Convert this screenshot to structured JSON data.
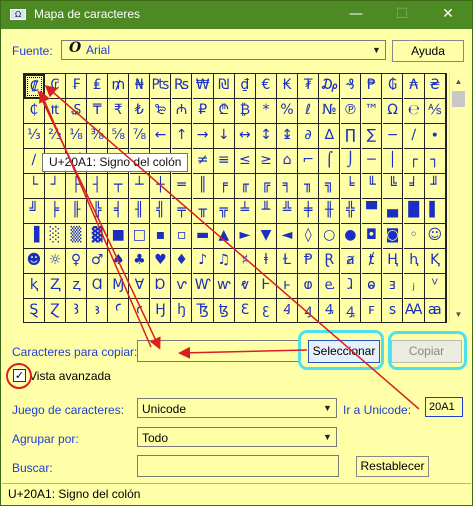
{
  "window": {
    "title": "Mapa de caracteres",
    "controls": {
      "minimize": "—",
      "maximize": "☐",
      "close": "✕"
    }
  },
  "font": {
    "label": "Fuente:",
    "icon_glyph": "O",
    "value": "Arial",
    "help_button": "Ayuda"
  },
  "grid": {
    "rows": [
      [
        "₡",
        "₢",
        "₣",
        "₤",
        "₥",
        "₦",
        "₧",
        "₨",
        "₩",
        "₪",
        "₫",
        "€",
        "₭",
        "₮",
        "₯",
        "₰",
        "₱",
        "₲",
        "₳",
        "₴"
      ],
      [
        "₵",
        "₶",
        "₷",
        "₸",
        "₹",
        "₺",
        "₻",
        "₼",
        "₽",
        "₾",
        "₿",
        "*",
        "%",
        "ℓ",
        "№",
        "℗",
        "™",
        "Ω",
        "℮",
        "⅍"
      ],
      [
        "⅓",
        "⅔",
        "⅛",
        "⅜",
        "⅝",
        "⅞",
        "←",
        "↑",
        "→",
        "↓",
        "↔",
        "↕",
        "↨",
        "∂",
        "∆",
        "∏",
        "∑",
        "−",
        "∕",
        "∙"
      ],
      [
        "∕",
        "·",
        "√",
        "∞",
        "∟",
        "∩",
        "∫",
        "≈",
        "≠",
        "≡",
        "≤",
        "≥",
        "⌂",
        "⌐",
        "⌠",
        "⌡",
        "─",
        "│",
        "┌",
        "┐"
      ],
      [
        "└",
        "┘",
        "├",
        "┤",
        "┬",
        "┴",
        "┼",
        "═",
        "║",
        "╒",
        "╓",
        "╔",
        "╕",
        "╖",
        "╗",
        "╘",
        "╙",
        "╚",
        "╛",
        "╜"
      ],
      [
        "╝",
        "╞",
        "╟",
        "╠",
        "╡",
        "╢",
        "╣",
        "╤",
        "╥",
        "╦",
        "╧",
        "╨",
        "╩",
        "╪",
        "╫",
        "╬",
        "▀",
        "▄",
        "█",
        "▌"
      ],
      [
        "▐",
        "░",
        "▒",
        "▓",
        "■",
        "□",
        "▪",
        "▫",
        "▬",
        "▲",
        "►",
        "▼",
        "◄",
        "◊",
        "○",
        "●",
        "◘",
        "◙",
        "◦",
        "☺"
      ],
      [
        "☻",
        "☼",
        "♀",
        "♂",
        "♠",
        "♣",
        "♥",
        "♦",
        "♪",
        "♫",
        "♯",
        "ⱡ",
        "Ɫ",
        "Ᵽ",
        "Ɽ",
        "ⱥ",
        "ⱦ",
        "Ⱨ",
        "ⱨ",
        "Ⱪ"
      ],
      [
        "ⱪ",
        "Ⱬ",
        "ⱬ",
        "Ɑ",
        "Ɱ",
        "Ɐ",
        "Ɒ",
        "ⱱ",
        "Ⱳ",
        "ⱳ",
        "ⱴ",
        "Ⱶ",
        "ⱶ",
        "ⱷ",
        "ⱸ",
        "ⱹ",
        "ⱺ",
        "ⱻ",
        "ⱼ",
        "ⱽ"
      ],
      [
        "Ȿ",
        "Ɀ",
        "Ꜣ",
        "ꜣ",
        "Ꜥ",
        "ꜥ",
        "Ꜧ",
        "ꜧ",
        "Ꜩ",
        "ꜩ",
        "Ꜫ",
        "ꜫ",
        "Ꜭ",
        "ꜭ",
        "Ꜯ",
        "ꜯ",
        "ꜰ",
        "ꜱ",
        "Ꜳ",
        "ꜳ"
      ]
    ],
    "tooltip": "U+20A1: Signo del colón"
  },
  "copy": {
    "label": "Caracteres para copiar:",
    "value": "",
    "select_button": "Seleccionar",
    "copy_button": "Copiar"
  },
  "advanced": {
    "label": "Vista avanzada",
    "checked": "✓"
  },
  "charset": {
    "label": "Juego de caracteres:",
    "value": "Unicode",
    "goto_label": "Ir a Unicode:",
    "goto_value": "20A1"
  },
  "group": {
    "label": "Agrupar por:",
    "value": "Todo"
  },
  "search": {
    "label": "Buscar:",
    "value": "",
    "reset_button": "Restablecer"
  },
  "status": {
    "text": "U+20A1: Signo del colón"
  },
  "colors": {
    "background": "#ffffa8",
    "titlebar": "#4e8a24",
    "label_blue": "#1f3ed8",
    "highlight_cyan": "#4fe0f0",
    "annotation_red": "#d82020"
  },
  "icons": [
    "charmap-app-icon",
    "font-o-icon",
    "chevron-down-icon",
    "checkmark-icon",
    "scroll-up-icon",
    "scroll-down-icon"
  ]
}
